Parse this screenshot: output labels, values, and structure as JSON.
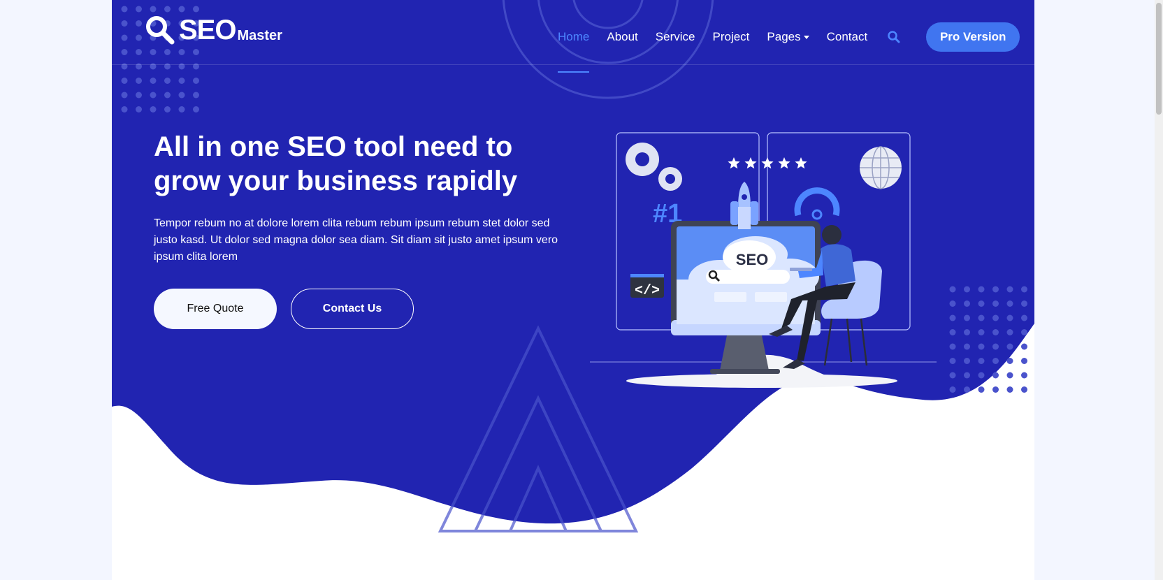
{
  "brand": {
    "main": "SEO",
    "sub": "Master"
  },
  "nav": {
    "items": [
      {
        "label": "Home",
        "active": true
      },
      {
        "label": "About"
      },
      {
        "label": "Service"
      },
      {
        "label": "Project"
      },
      {
        "label": "Pages",
        "dropdown": true
      },
      {
        "label": "Contact"
      }
    ],
    "search_icon": "search-icon",
    "cta_label": "Pro Version"
  },
  "hero": {
    "title": "All in one SEO tool need to grow your business rapidly",
    "text": "Tempor rebum no at dolore lorem clita rebum rebum ipsum rebum stet dolor sed justo kasd. Ut dolor sed magna dolor sea diam. Sit diam sit justo amet ipsum vero ipsum clita lorem",
    "primary_button": "Free Quote",
    "secondary_button": "Contact Us"
  },
  "illustration": {
    "screen_label": "SEO",
    "rank_label": "#1",
    "code_label": "</>",
    "stars": 5
  },
  "colors": {
    "hero_bg": "#2124b1",
    "accent": "#4075f0",
    "active_link": "#4d86ff",
    "page_bg": "#f3f6ff"
  }
}
